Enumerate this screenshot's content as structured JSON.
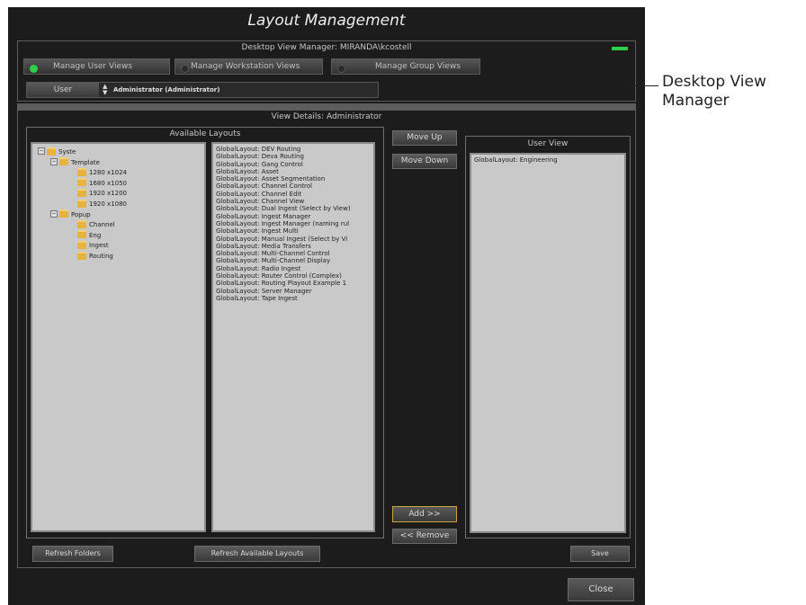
{
  "window": {
    "title": "Layout Management"
  },
  "desktop_view_manager": {
    "header": "Desktop View Manager: MIRANDA\\kcostell",
    "modes": [
      {
        "label": "Manage User Views",
        "selected": true
      },
      {
        "label": "Manage Workstation Views",
        "selected": false
      },
      {
        "label": "Manage Group Views",
        "selected": false
      }
    ],
    "user_label": "User",
    "user_value": "Administrator (Administrator)",
    "status_color": "#2fcf4a"
  },
  "view_details": {
    "header": "View Details: Administrator",
    "available_layouts_header": "Available Layouts",
    "user_view_header": "User View",
    "tree": [
      {
        "label": "Syste",
        "level": 0,
        "expander": "−"
      },
      {
        "label": "Template",
        "level": 1,
        "expander": "−"
      },
      {
        "label": "1280 x1024",
        "level": 2,
        "expander": ""
      },
      {
        "label": "1680 x1050",
        "level": 2,
        "expander": ""
      },
      {
        "label": "1920 x1200",
        "level": 2,
        "expander": ""
      },
      {
        "label": "1920 x1080",
        "level": 2,
        "expander": ""
      },
      {
        "label": "Popup",
        "level": 1,
        "expander": "−"
      },
      {
        "label": "Channel",
        "level": 2,
        "expander": ""
      },
      {
        "label": "Eng",
        "level": 2,
        "expander": ""
      },
      {
        "label": "Ingest",
        "level": 2,
        "expander": ""
      },
      {
        "label": "Routing",
        "level": 2,
        "expander": ""
      }
    ],
    "layouts": [
      "GlobalLayout: DEV Routing",
      "GlobalLayout: Deva Routing",
      "GlobalLayout: Gang Control",
      "GlobalLayout: Asset",
      "GlobalLayout: Asset Segmentation",
      "GlobalLayout: Channel Control",
      "GlobalLayout: Channel Edit",
      "GlobalLayout: Channel View",
      "GlobalLayout: Dual Ingest (Select by View)",
      "GlobalLayout: Ingest Manager",
      "GlobalLayout: Ingest Manager (naming rul",
      "GlobalLayout: Ingest Multi",
      "GlobalLayout: Manual Ingest (Select by Vi",
      "GlobalLayout: Media Transfers",
      "GlobalLayout: Multi-Channel Control",
      "GlobalLayout: Multi-Channel Display",
      "GlobalLayout: Radio Ingest",
      "GlobalLayout: Router Control (Complex)",
      "GlobalLayout: Routing Playout Example 1",
      "GlobalLayout: Server Manager",
      "GlobalLayout: Tape Ingest"
    ],
    "user_view_items": [
      "GlobalLayout: Engineering"
    ],
    "buttons": {
      "move_up": "Move Up",
      "move_down": "Move Down",
      "add": "Add >>",
      "remove": "<< Remove",
      "refresh_folders": "Refresh Folders",
      "refresh_layouts": "Refresh Available Layouts",
      "save": "Save"
    }
  },
  "close_label": "Close",
  "callout": {
    "line1": "Desktop View",
    "line2": "Manager"
  }
}
